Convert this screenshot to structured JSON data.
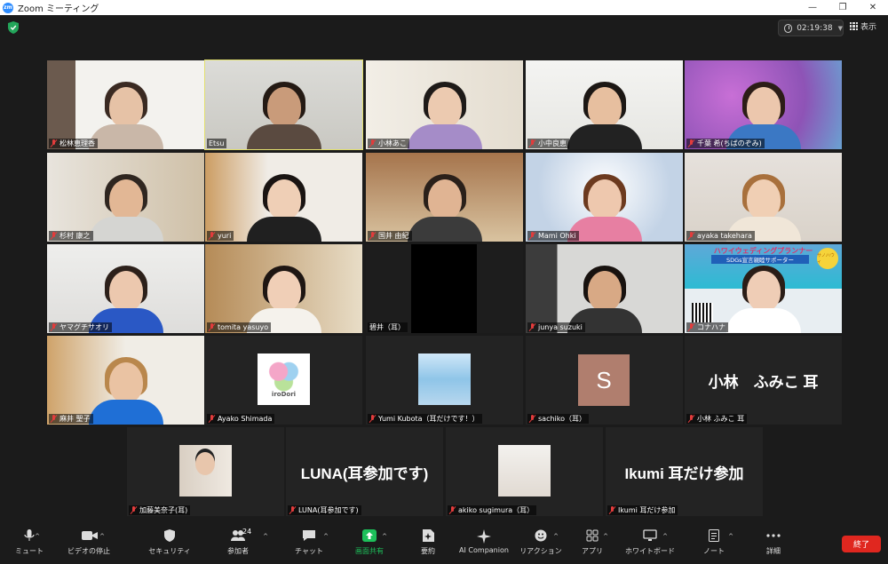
{
  "window": {
    "title": "Zoom ミーティング",
    "logo": "zm"
  },
  "top": {
    "timer": "02:19:38",
    "view_label": "表示"
  },
  "participants": [
    {
      "name": "松林恵理香",
      "muted": true
    },
    {
      "name": "Etsu",
      "muted": false,
      "active": true
    },
    {
      "name": "小林あこ",
      "muted": true
    },
    {
      "name": "小中良恵",
      "muted": true
    },
    {
      "name": "千葉 希(ちばのぞみ)",
      "muted": true
    },
    {
      "name": "杉村 康之",
      "muted": true
    },
    {
      "name": "yuri",
      "muted": true
    },
    {
      "name": "国井 由紀",
      "muted": true
    },
    {
      "name": "Mami Ohki",
      "muted": true
    },
    {
      "name": "ayaka takehara",
      "muted": true
    },
    {
      "name": "ヤマグチサオリ",
      "muted": true
    },
    {
      "name": "tomita yasuyo",
      "muted": true
    },
    {
      "name": "碧井（耳）",
      "muted": false
    },
    {
      "name": "junya suzuki",
      "muted": true
    },
    {
      "name": "コナハナ",
      "muted": true
    },
    {
      "name": "麻井 聖子",
      "muted": true
    },
    {
      "name": "Ayako Shimada",
      "muted": true
    },
    {
      "name": "Yumi Kubota（耳だけです！）",
      "muted": true
    },
    {
      "name": "sachiko（耳）",
      "muted": true,
      "avatar_letter": "S"
    },
    {
      "name": "小林 ふみこ 耳",
      "muted": true,
      "display_text": "小林　ふみこ 耳"
    },
    {
      "name": "加藤美奈子(耳)",
      "muted": true
    },
    {
      "name": "LUNA(耳参加です)",
      "muted": true,
      "display_text": "LUNA(耳参加です)"
    },
    {
      "name": "akiko sugimura（耳）",
      "muted": true
    },
    {
      "name": "Ikumi 耳だけ参加",
      "muted": true,
      "display_text": "Ikumi 耳だけ参加"
    }
  ],
  "banner": {
    "line1": "ハワイウェディングプランナー",
    "line2": "SDGs宣言親睦サポーター",
    "tag": "サノハウィ",
    "logo": "iroDori"
  },
  "toolbar": {
    "mute": "ミュート",
    "video": "ビデオの停止",
    "security": "セキュリティ",
    "participants": "参加者",
    "participants_count": "24",
    "chat": "チャット",
    "share": "画面共有",
    "summary": "要約",
    "ai": "AI Companion",
    "reactions": "リアクション",
    "apps": "アプリ",
    "whiteboard": "ホワイトボード",
    "notes": "ノート",
    "more": "詳細",
    "end": "終了"
  },
  "colors": {
    "accent": "#2d8cff",
    "active_border": "#e2e06e",
    "end": "#e0271f",
    "share": "#1dbf5a",
    "muted_mic": "#e23c3c"
  }
}
